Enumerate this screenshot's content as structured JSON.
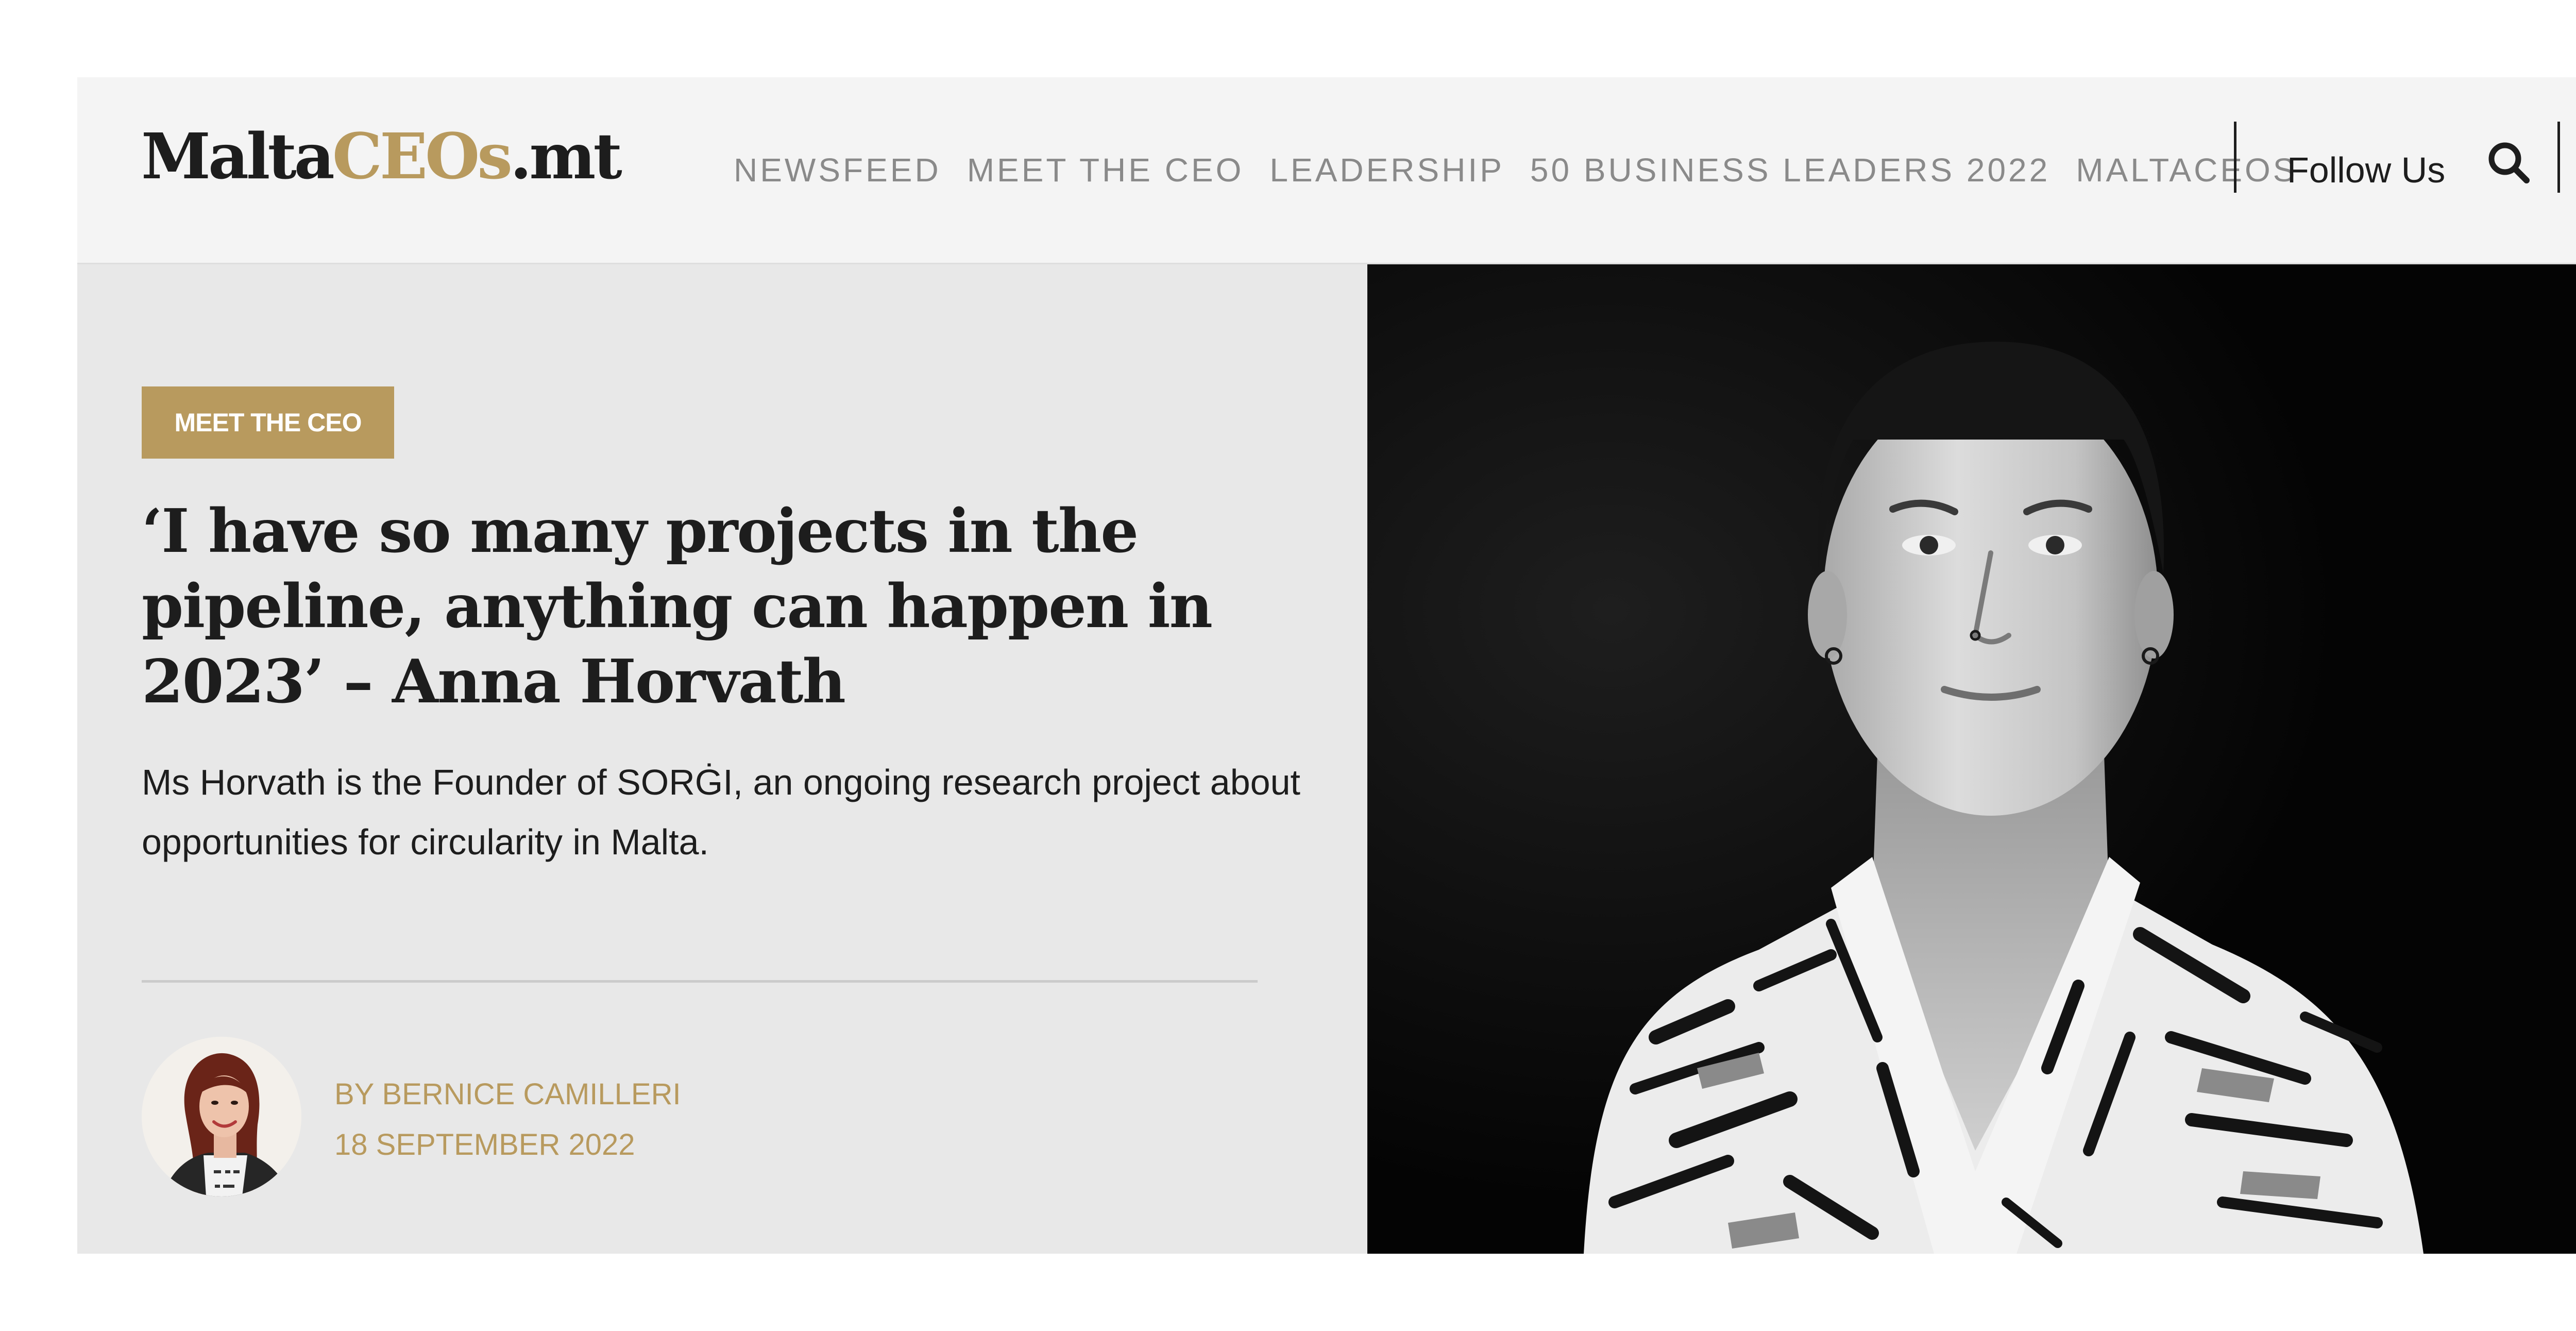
{
  "brand": {
    "logo_part1": "Malta",
    "logo_part2": "CEOs",
    "logo_part3": ".mt"
  },
  "nav": {
    "items": [
      {
        "label": "NEWSFEED"
      },
      {
        "label": "MEET THE CEO"
      },
      {
        "label": "LEADERSHIP"
      },
      {
        "label": "50 BUSINESS LEADERS 2022"
      },
      {
        "label": "MALTACEOS"
      }
    ],
    "follow_label": "Follow Us",
    "search_icon": "search-icon"
  },
  "article": {
    "category": "MEET THE CEO",
    "headline": "‘I have so many projects in the pipeline, anything can happen in 2023’ – Anna Horvath",
    "summary": "Ms Horvath is the Founder of SORĠI, an ongoing research project about opportunities for circularity in Malta.",
    "author": "BY BERNICE CAMILLERI",
    "date": "18 SEPTEMBER 2022"
  },
  "colors": {
    "accent": "#b89a5e",
    "text": "#1d1d1d",
    "nav_text": "#8a8a8a",
    "header_bg": "#f4f4f4",
    "content_bg": "#e8e8e8"
  }
}
